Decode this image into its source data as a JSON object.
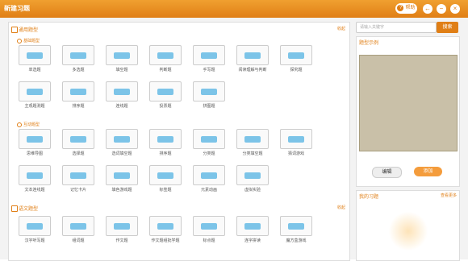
{
  "window": {
    "title": "新建习题",
    "help": "帮助"
  },
  "search": {
    "placeholder": "请输入关键字",
    "button": "搜索"
  },
  "sections": {
    "common": {
      "title": "通用题型",
      "collapse": "收起"
    },
    "basic": {
      "title": "基础题型"
    },
    "interactive": {
      "title": "互动题型"
    },
    "language": {
      "title": "语文题型",
      "collapse": "收起"
    }
  },
  "basic_items": [
    "单选题",
    "多选题",
    "填空题",
    "判断题",
    "手写题",
    "阅读理解与判断",
    "探究题",
    "主观题测题",
    "排序题",
    "连线题",
    "投票题",
    "拼图题"
  ],
  "interactive_items": [
    "思维导图",
    "选择题",
    "选词填空题",
    "排序题",
    "分类题",
    "分类填空题",
    "猜词游戏",
    "文本连线题",
    "记忆卡片",
    "填色游戏题",
    "标签题",
    "元素动画",
    "虚拟实验"
  ],
  "language_items": [
    "汉字听写题",
    "组词题",
    "作文题",
    "作文题组批学题",
    "标点题",
    "连字拼读",
    "魔方盒游戏"
  ],
  "preview": {
    "title": "题型示例",
    "btn_edit": "编辑",
    "btn_add": "添加"
  },
  "mine": {
    "title": "我的习题",
    "more": "查看更多"
  }
}
